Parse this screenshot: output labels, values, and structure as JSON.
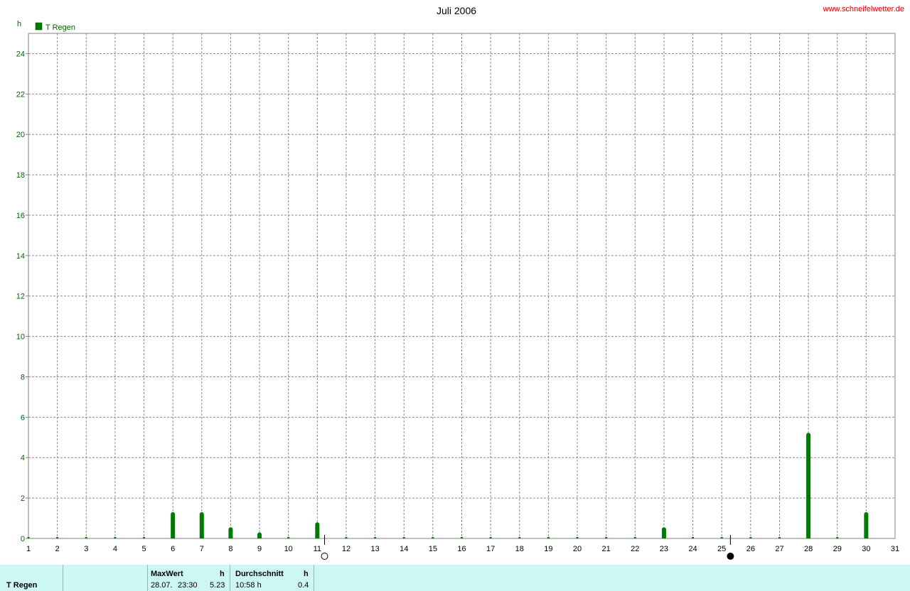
{
  "header": {
    "site": "www.schneifelwetter.de"
  },
  "chart_data": {
    "type": "bar",
    "title": "Juli 2006",
    "ylabel": "h",
    "xlabel": "",
    "ylim": [
      0,
      25
    ],
    "xlim": [
      1,
      31
    ],
    "yticks": [
      0,
      2,
      4,
      6,
      8,
      10,
      12,
      14,
      16,
      18,
      20,
      22,
      24
    ],
    "xticks": [
      1,
      2,
      3,
      4,
      5,
      6,
      7,
      8,
      9,
      10,
      11,
      12,
      13,
      14,
      15,
      16,
      17,
      18,
      19,
      20,
      21,
      22,
      23,
      24,
      25,
      26,
      27,
      28,
      29,
      30,
      31
    ],
    "grid": true,
    "legend": "top-left",
    "series": [
      {
        "name": "T Regen",
        "color": "#007a00",
        "x": [
          1,
          2,
          3,
          4,
          5,
          6,
          7,
          8,
          9,
          10,
          11,
          12,
          13,
          14,
          15,
          16,
          17,
          18,
          19,
          20,
          21,
          22,
          23,
          24,
          25,
          26,
          27,
          28,
          29,
          30
        ],
        "values": [
          0,
          0,
          0,
          0,
          0,
          1.3,
          1.3,
          0.55,
          0.3,
          0,
          0.8,
          0,
          0,
          0,
          0,
          0,
          0,
          0,
          0,
          0,
          0,
          0,
          0.55,
          0,
          0,
          0,
          0,
          5.23,
          0,
          1.3
        ]
      }
    ],
    "moon_phases": [
      {
        "day": 11.25,
        "phase": "full-moon"
      },
      {
        "day": 25.3,
        "phase": "new-moon"
      }
    ]
  },
  "footer": {
    "series_label": "T Regen",
    "max_header": "MaxWert",
    "max_unit": "h",
    "max_date": "28.07.",
    "max_time": "23:30",
    "max_value": "5.23",
    "avg_header": "Durchschnitt",
    "avg_unit": "h",
    "avg_time": "10:58 h",
    "avg_value": "0.4"
  }
}
